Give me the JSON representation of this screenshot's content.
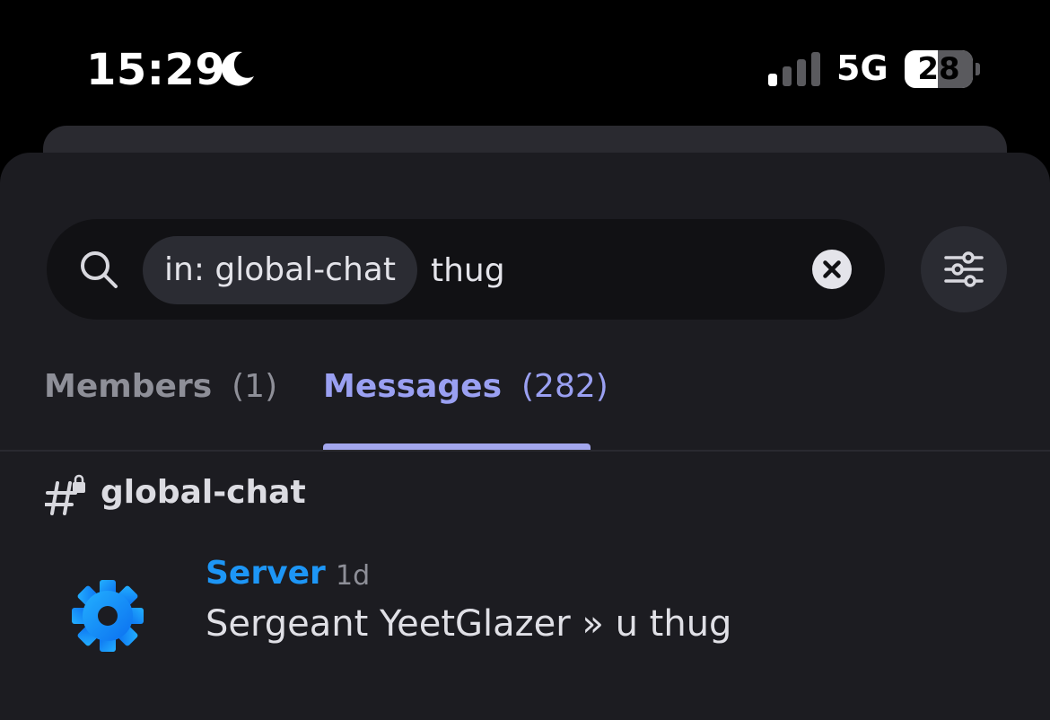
{
  "status_bar": {
    "time": "15:29",
    "network": "5G",
    "battery": "28",
    "battery_level": 0.28
  },
  "search": {
    "filter_chip": "in: global-chat",
    "query": "thug"
  },
  "tabs": [
    {
      "label": "Members",
      "count": "(1)",
      "active": false
    },
    {
      "label": "Messages",
      "count": "(282)",
      "active": true
    }
  ],
  "channel": {
    "name": "global-chat"
  },
  "message": {
    "author": "Server",
    "timestamp": "1d",
    "text": "Sergeant YeetGlazer » u thug"
  },
  "icons": {
    "moon": "moon-icon",
    "signal": "signal-icon",
    "search": "search-icon",
    "clear": "close-circle-icon",
    "filter": "sliders-icon",
    "channel": "locked-hashtag-icon",
    "avatar": "gear-icon"
  },
  "colors": {
    "accent": "#9aa0f2",
    "author": "#1d96f6",
    "background": "#1c1c21"
  }
}
